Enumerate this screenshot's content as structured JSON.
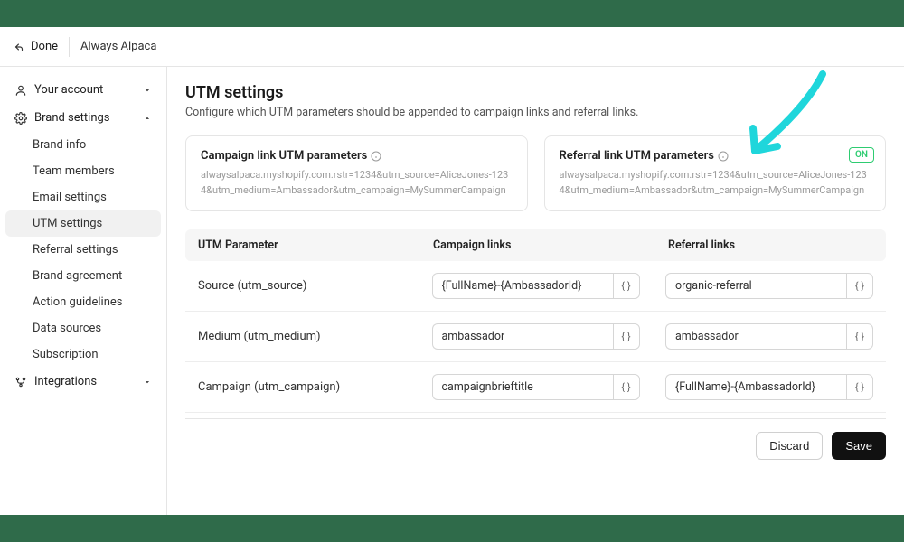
{
  "topbar": {
    "done_label": "Done",
    "brand_name": "Always Alpaca"
  },
  "sidebar": {
    "account_label": "Your account",
    "brand_settings_label": "Brand settings",
    "brand_items": [
      {
        "label": "Brand info"
      },
      {
        "label": "Team members"
      },
      {
        "label": "Email settings"
      },
      {
        "label": "UTM settings"
      },
      {
        "label": "Referral settings"
      },
      {
        "label": "Brand agreement"
      },
      {
        "label": "Action guidelines"
      },
      {
        "label": "Data sources"
      },
      {
        "label": "Subscription"
      }
    ],
    "integrations_label": "Integrations"
  },
  "page": {
    "title": "UTM settings",
    "subtitle": "Configure which UTM parameters should be appended to campaign links and referral links."
  },
  "cards": {
    "campaign": {
      "title": "Campaign link UTM parameters",
      "sample": "alwaysalpaca.myshopify.com.rstr=1234&utm_source=AliceJones-1234&utm_medium=Ambassador&utm_campaign=MySummerCampaign"
    },
    "referral": {
      "title": "Referral link UTM parameters",
      "sample": "alwaysalpaca.myshopify.com.rstr=1234&utm_source=AliceJones-1234&utm_medium=Ambassador&utm_campaign=MySummerCampaign",
      "badge": "ON"
    }
  },
  "table": {
    "headers": {
      "param": "UTM Parameter",
      "campaign": "Campaign links",
      "referral": "Referral links"
    },
    "rows": [
      {
        "param": "Source (utm_source)",
        "campaign_value": "{FullName}-{AmbassadorId}",
        "referral_value": "organic-referral"
      },
      {
        "param": "Medium (utm_medium)",
        "campaign_value": "ambassador",
        "referral_value": "ambassador"
      },
      {
        "param": "Campaign (utm_campaign)",
        "campaign_value": "campaignbrieftitle",
        "referral_value": "{FullName}-{AmbassadorId}"
      }
    ],
    "braces_label": "{ }"
  },
  "actions": {
    "discard": "Discard",
    "save": "Save"
  },
  "colors": {
    "frame_green": "#2f6b4a",
    "arrow_cyan": "#1fd6db",
    "badge_green": "#2ecc71"
  }
}
